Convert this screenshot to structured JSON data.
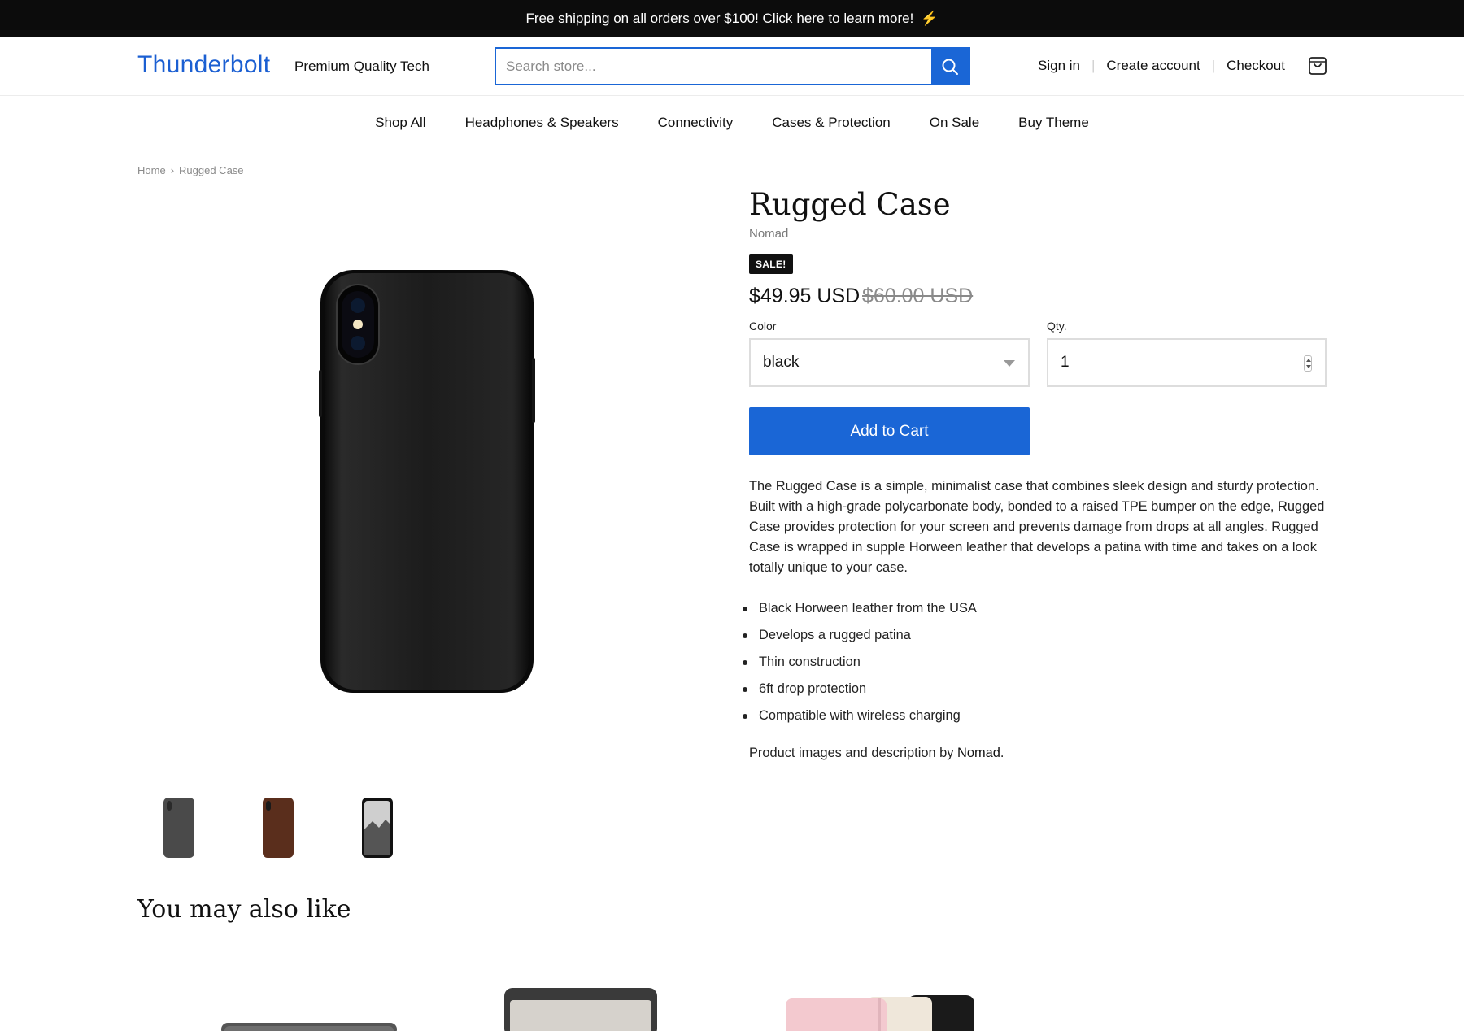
{
  "announcement": {
    "text_before": "Free shipping on all orders over $100! Click",
    "link": "here",
    "text_after": "to learn more!",
    "icon": "lightning-icon"
  },
  "header": {
    "logo": "Thunderbolt",
    "tagline": "Premium Quality Tech",
    "search": {
      "placeholder": "Search store...",
      "icon": "search-icon"
    },
    "account_links": [
      "Sign in",
      "Create account",
      "Checkout"
    ],
    "cart_icon": "shopping-bag-icon"
  },
  "nav": [
    "Shop All",
    "Headphones & Speakers",
    "Connectivity",
    "Cases & Protection",
    "On Sale",
    "Buy Theme"
  ],
  "breadcrumb": {
    "home": "Home",
    "current": "Rugged Case",
    "separator": "›"
  },
  "product": {
    "title": "Rugged Case",
    "vendor": "Nomad",
    "badge": "SALE!",
    "price": "$49.95 USD",
    "compare_price": "$60.00 USD",
    "color_label": "Color",
    "color_value": "black",
    "qty_label": "Qty.",
    "qty_value": "1",
    "add_to_cart": "Add to Cart",
    "description": "The Rugged Case is a simple, minimalist case that combines sleek design and sturdy protection. Built with a high-grade polycarbonate body, bonded to a raised TPE bumper on the edge, Rugged Case provides protection for your screen and prevents damage from drops at all angles. Rugged Case is wrapped in supple Horween leather that develops a patina with time and takes on a look totally unique to your case.",
    "features": [
      "Black Horween leather from the USA",
      "Develops a rugged patina",
      "Thin construction",
      "6ft drop protection",
      "Compatible with wireless charging"
    ],
    "credit_prefix": "Product images and description by",
    "credit_link": "Nomad",
    "credit_suffix": "."
  },
  "recommendations": {
    "title": "You may also like"
  },
  "colors": {
    "accent": "#1a66d6",
    "logo": "#1b5fd2",
    "announcement_bg": "#0c0c0c",
    "bolt": "#f2c200"
  }
}
